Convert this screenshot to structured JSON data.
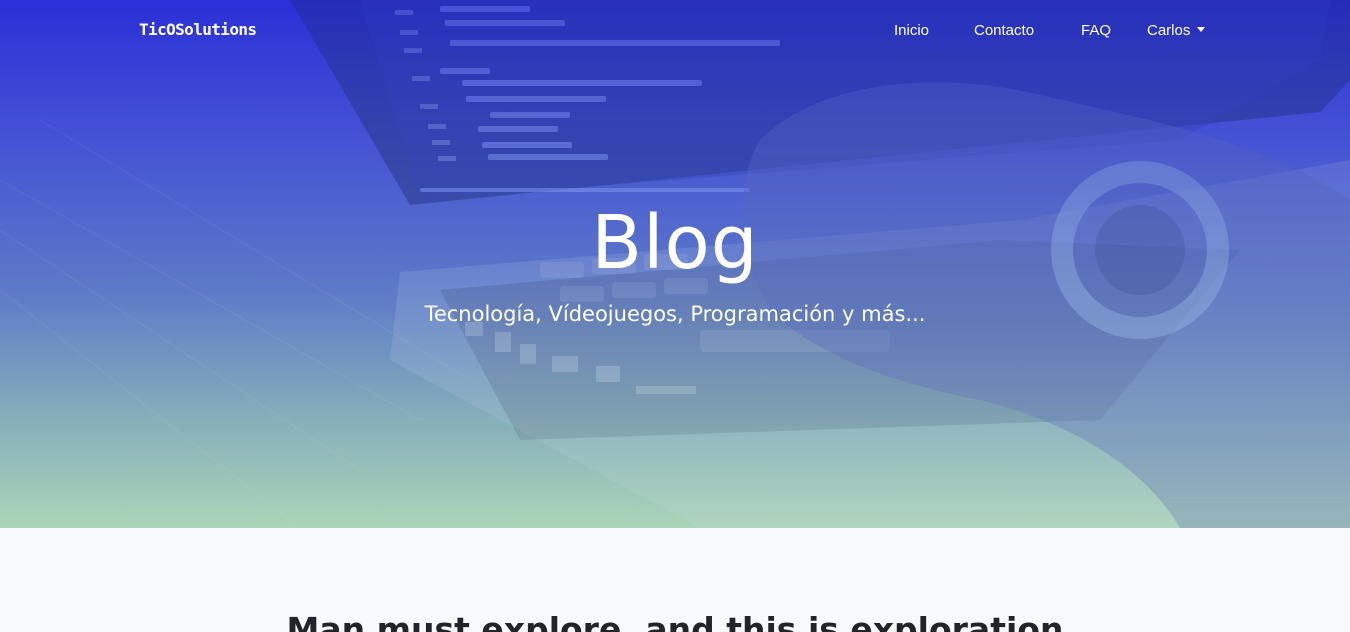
{
  "navbar": {
    "brand": "TicOSolutions",
    "links": [
      {
        "label": "Inicio"
      },
      {
        "label": "Contacto"
      },
      {
        "label": "FAQ"
      }
    ],
    "user": {
      "label": "Carlos",
      "icon": "caret-down-icon"
    }
  },
  "hero": {
    "title": "Blog",
    "subtitle": "Tecnología, Vídeojuegos, Programación y más...",
    "background": "laptop-coding-photo",
    "overlay_colors": [
      "#2c2fd6",
      "#a8d2b6"
    ]
  },
  "content": {
    "heading": "Man must explore, and this is exploration"
  }
}
